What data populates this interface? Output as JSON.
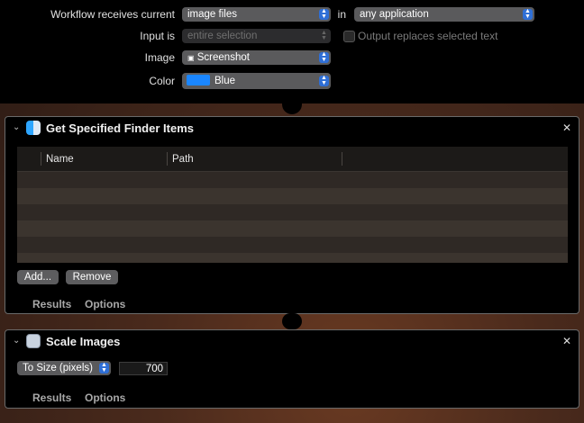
{
  "workflow": {
    "receives_label": "Workflow receives current",
    "receives_value": "image files",
    "in_label": "in",
    "application_value": "any application",
    "input_is_label": "Input is",
    "input_is_value": "entire selection",
    "output_replaces_label": "Output replaces selected text",
    "image_label": "Image",
    "image_value": "Screenshot",
    "color_label": "Color",
    "color_value": "Blue",
    "color_swatch": "#1a86ff"
  },
  "finder_action": {
    "title": "Get Specified Finder Items",
    "icon": "finder-icon",
    "columns": [
      "Name",
      "Path"
    ],
    "add_button": "Add...",
    "remove_button": "Remove",
    "tabs": [
      "Results",
      "Options"
    ]
  },
  "scale_action": {
    "title": "Scale Images",
    "icon": "preview-icon",
    "mode_value": "To Size (pixels)",
    "size_value": "700",
    "tabs": [
      "Results",
      "Options"
    ]
  },
  "colors": {
    "accent": "#2f6fd6",
    "panel_bg": "#000000"
  }
}
